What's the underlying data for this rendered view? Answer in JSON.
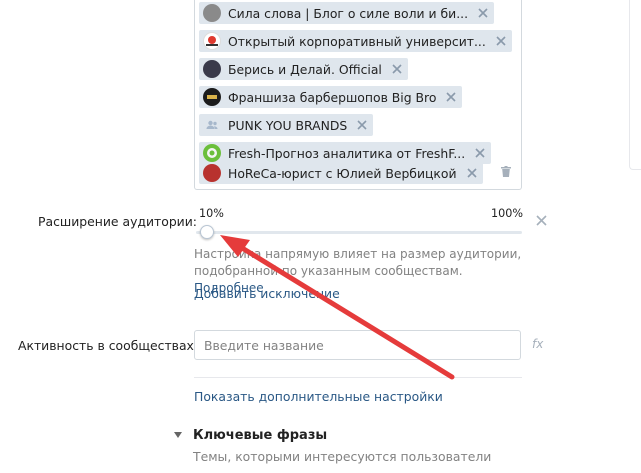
{
  "communities": {
    "tags": [
      {
        "label": "Сила слова | Блог о силе воли и би...",
        "icon": "avatar-face",
        "avatar_color": "#8a8a8a"
      },
      {
        "label": "Открытый корпоративный университ...",
        "icon": "sfera-logo",
        "avatar_color": "#ffffff"
      },
      {
        "label": "Берись и Делай. Official",
        "icon": "avatar-face",
        "avatar_color": "#3a3a4a"
      },
      {
        "label": "Франшиза барбершопов Big Bro",
        "icon": "big-bro-logo",
        "avatar_color": "#1c1c1c"
      },
      {
        "label": "PUNK YOU BRANDS",
        "icon": "default-group-icon",
        "avatar_color": "#dfe6ed"
      },
      {
        "label": "Fresh-Прогноз аналитика от FreshF...",
        "icon": "fresh-logo",
        "avatar_color": "#6bbf3b"
      },
      {
        "label": "HoReCa-юрист с Юлией Вербицкой",
        "icon": "avatar-face",
        "avatar_color": "#b8322e"
      }
    ]
  },
  "audience_expansion": {
    "label": "Расширение аудитории:",
    "min_label": "10%",
    "max_label": "100%",
    "value_percent": 10,
    "hint": "Настройка напрямую влияет на размер аудитории, подобранной по указанным сообществам.",
    "more_link": "Подробнее"
  },
  "add_exclusion_link": "Добавить исключение",
  "community_activity": {
    "label": "Активность в сообществах:",
    "placeholder": "Введите название",
    "fx_label": "fx"
  },
  "show_more_settings_link": "Показать дополнительные настройки",
  "key_phrases": {
    "title": "Ключевые фразы",
    "description": "Темы, которыми интересуются пользователи"
  },
  "colors": {
    "accent": "#5181b8",
    "link": "#2a5885",
    "tag_bg": "#dfe6ed",
    "annotation_arrow": "#e53b3b"
  }
}
